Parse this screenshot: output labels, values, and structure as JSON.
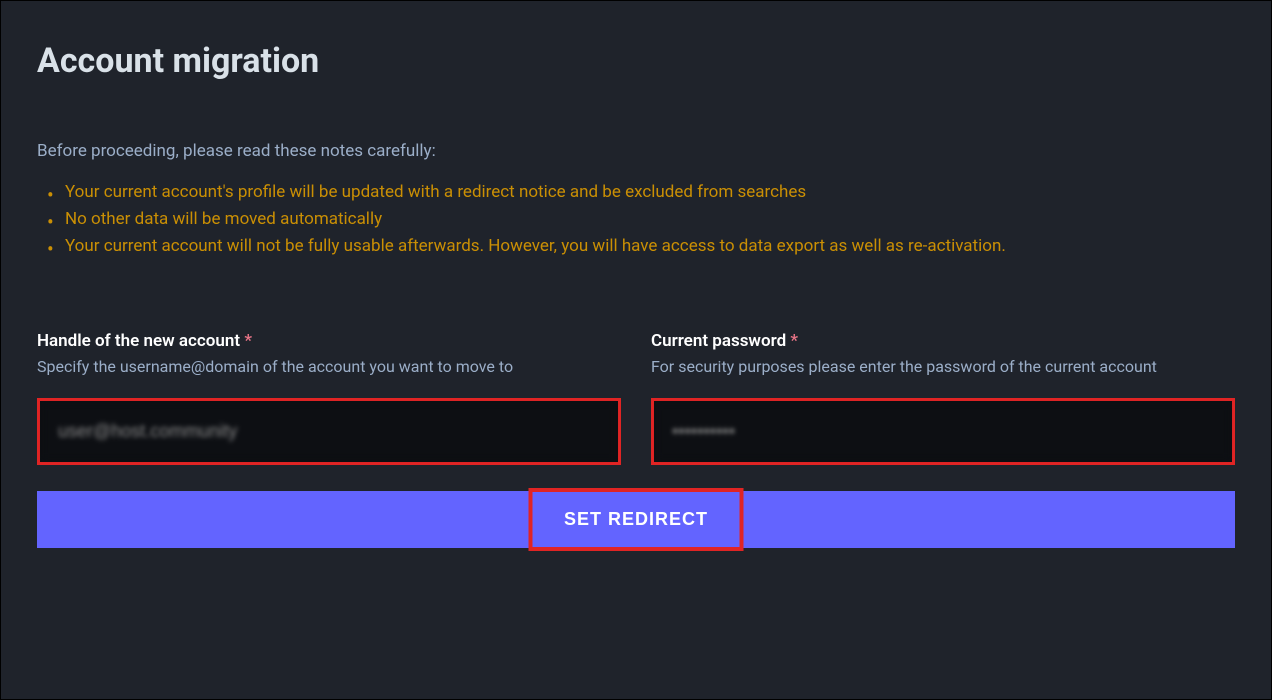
{
  "page": {
    "title": "Account migration",
    "intro": "Before proceeding, please read these notes carefully:",
    "notes": [
      "Your current account's profile will be updated with a redirect notice and be excluded from searches",
      "No other data will be moved automatically",
      "Your current account will not be fully usable afterwards. However, you will have access to data export as well as re-activation."
    ]
  },
  "form": {
    "handle": {
      "label": "Handle of the new account",
      "required": "*",
      "hint": "Specify the username@domain of the account you want to move to",
      "value": "user@host.community"
    },
    "password": {
      "label": "Current password",
      "required": "*",
      "hint": "For security purposes please enter the password of the current account",
      "value": "••••••••••"
    },
    "submit": "SET REDIRECT"
  }
}
